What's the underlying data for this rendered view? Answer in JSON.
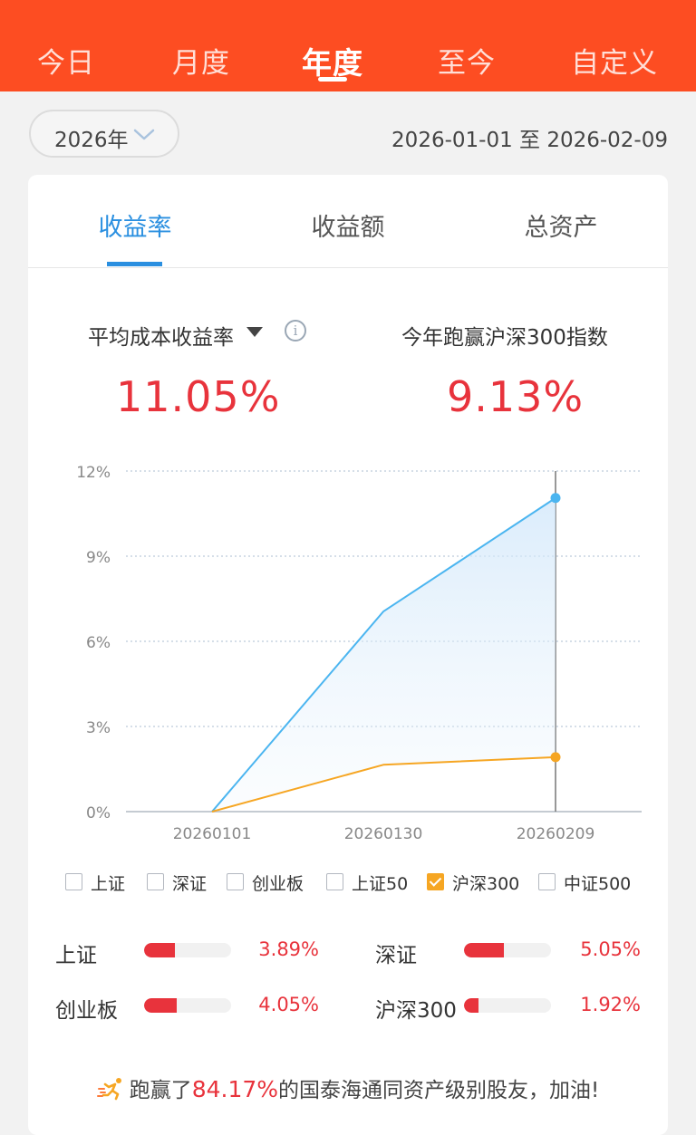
{
  "colors": {
    "brand": "#fd4d22",
    "accent_blue": "#2a8fe0",
    "gain_red": "#e8333c",
    "series_portfolio": "#4bb5f0",
    "series_hs300": "#f6a623"
  },
  "period_tabs": [
    {
      "label": "今日",
      "active": false
    },
    {
      "label": "月度",
      "active": false
    },
    {
      "label": "年度",
      "active": true
    },
    {
      "label": "至今",
      "active": false
    },
    {
      "label": "自定义",
      "active": false
    }
  ],
  "year_select": {
    "value": "2026年",
    "icon": "chevron-down-icon"
  },
  "date_range": "2026-01-01 至 2026-02-09",
  "metric_tabs": [
    {
      "label": "收益率",
      "active": true
    },
    {
      "label": "收益额",
      "active": false
    },
    {
      "label": "总资产",
      "active": false
    }
  ],
  "kpi": {
    "left_label": "平均成本收益率",
    "left_value": "11.05%",
    "right_label": "今年跑赢沪深300指数",
    "right_value": "9.13%"
  },
  "chart_data": {
    "type": "line",
    "x": [
      "20260101",
      "20260130",
      "20260209"
    ],
    "yticks": [
      "0%",
      "3%",
      "6%",
      "9%",
      "12%"
    ],
    "ylim": [
      0,
      12
    ],
    "grid": true,
    "series": [
      {
        "values": [
          0,
          7.05,
          11.05
        ],
        "color": "#4bb5f0",
        "area": true
      },
      {
        "name": "沪深300",
        "values": [
          0,
          1.65,
          1.92
        ],
        "color": "#f6a623",
        "area": false
      }
    ],
    "crosshair_x": "20260209"
  },
  "legend": [
    {
      "label": "上证",
      "checked": false
    },
    {
      "label": "深证",
      "checked": false
    },
    {
      "label": "创业板",
      "checked": false
    },
    {
      "label": "上证50",
      "checked": false
    },
    {
      "label": "沪深300",
      "checked": true
    },
    {
      "label": "中证500",
      "checked": false
    }
  ],
  "comparisons": [
    {
      "name": "上证",
      "value": "3.89%",
      "fraction": 0.35
    },
    {
      "name": "深证",
      "value": "5.05%",
      "fraction": 0.46
    },
    {
      "name": "创业板",
      "value": "4.05%",
      "fraction": 0.37
    },
    {
      "name": "沪深300",
      "value": "1.92%",
      "fraction": 0.17
    }
  ],
  "footer": {
    "prefix": "跑赢了",
    "percent": "84.17%",
    "suffix": "的国泰海通同资产级别股友，加油!",
    "icon": "runner-icon"
  }
}
